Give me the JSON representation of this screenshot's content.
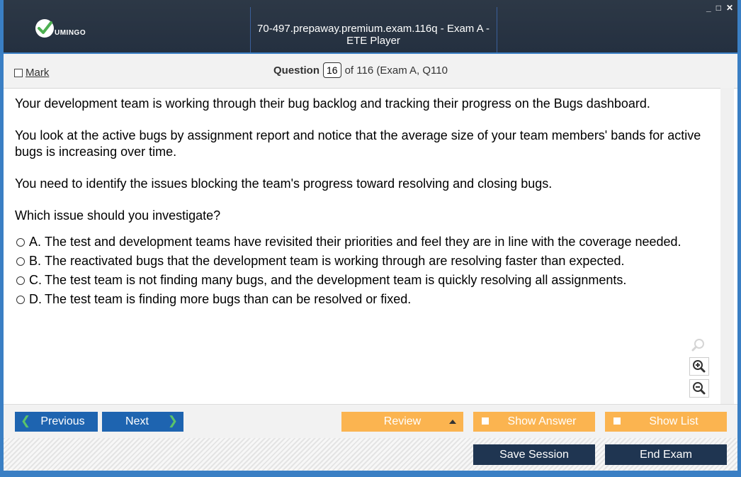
{
  "app": {
    "logo_text": "UMINGO",
    "window_title": "70-497.prepaway.premium.exam.116q - Exam A - ETE Player",
    "win_min": "_",
    "win_max": "□",
    "win_close": "✕"
  },
  "header": {
    "mark_label": "Mark",
    "question_label": "Question",
    "question_number": "16",
    "question_suffix": "of 116 (Exam A, Q110"
  },
  "question": {
    "paragraphs": [
      "Your development team is working through their bug backlog and tracking their progress on the Bugs dashboard.",
      "You look at the active bugs by assignment report and notice that the average size of your team members' bands for active bugs is increasing over time.",
      "You need to identify the issues blocking the team's progress toward resolving and closing bugs.",
      "Which issue should you investigate?"
    ],
    "answers": [
      {
        "letter": "A.",
        "text": "The test and development teams have revisited their priorities and feel they are in line with the coverage needed."
      },
      {
        "letter": "B.",
        "text": "The reactivated bugs that the development team is working through are resolving faster than expected."
      },
      {
        "letter": "C.",
        "text": "The test team is not finding many bugs, and the development team is quickly resolving all assignments."
      },
      {
        "letter": "D.",
        "text": "The test team is finding more bugs than can be resolved or fixed."
      }
    ]
  },
  "zoom": {
    "icons": [
      "magnifier-icon",
      "zoom-in-icon",
      "zoom-out-icon"
    ]
  },
  "nav": {
    "previous_label": "Previous",
    "next_label": "Next",
    "review_label": "Review",
    "show_answer_label": "Show Answer",
    "show_list_label": "Show List"
  },
  "footer": {
    "save_session_label": "Save Session",
    "end_exam_label": "End Exam"
  },
  "colors": {
    "titlebar": "#2d3846",
    "accent_blue": "#1e64b0",
    "orange": "#fbb450",
    "dark_button": "#1f3551",
    "green_check": "#4caf50"
  }
}
